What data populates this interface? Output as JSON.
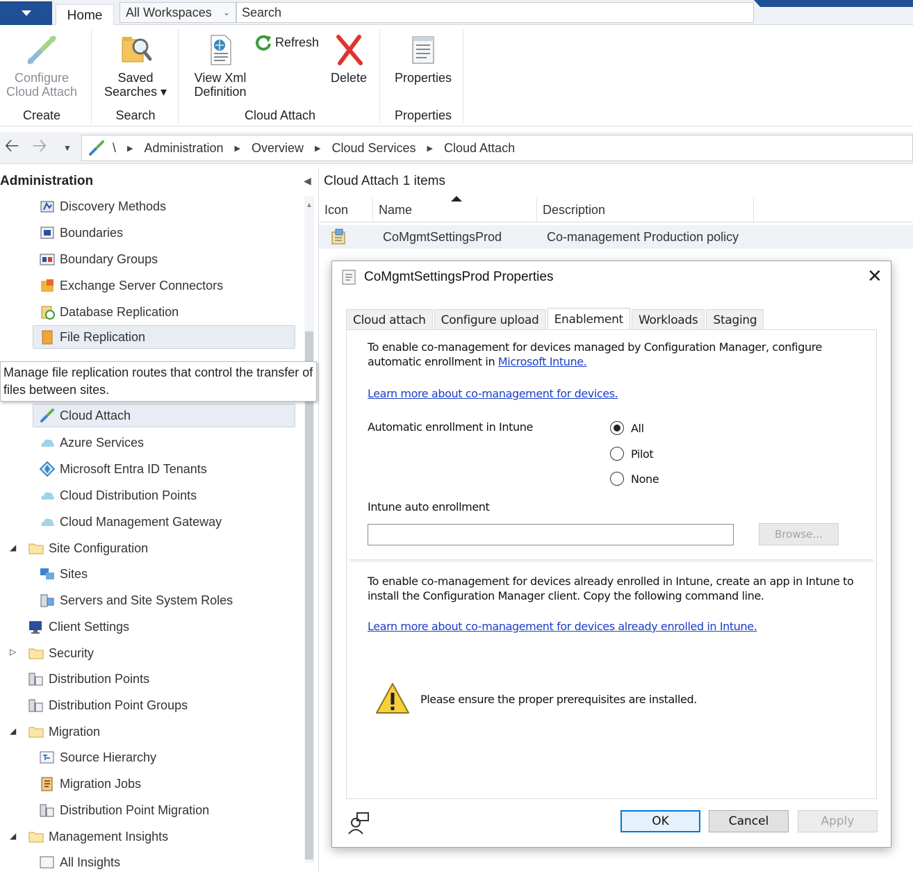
{
  "topbar": {
    "home_tab": "Home",
    "workspace_select": "All Workspaces",
    "search_label": "Search"
  },
  "ribbon": {
    "configure_cloud_attach": {
      "line1": "Configure",
      "line2": "Cloud Attach"
    },
    "saved_searches": {
      "line1": "Saved",
      "line2": "Searches ▾"
    },
    "view_xml": {
      "line1": "View Xml",
      "line2": "Definition"
    },
    "refresh": "Refresh",
    "delete": "Delete",
    "properties": "Properties",
    "groups": {
      "create": "Create",
      "search": "Search",
      "cloud_attach": "Cloud Attach",
      "properties": "Properties"
    }
  },
  "address": {
    "root": "\\",
    "crumbs": [
      "Administration",
      "Overview",
      "Cloud Services",
      "Cloud Attach"
    ]
  },
  "nav": {
    "header": "Administration",
    "items": [
      {
        "label": "Discovery Methods",
        "icon": "discovery-icon"
      },
      {
        "label": "Boundaries",
        "icon": "boundary-icon"
      },
      {
        "label": "Boundary Groups",
        "icon": "boundary-group-icon"
      },
      {
        "label": "Exchange Server Connectors",
        "icon": "exchange-icon"
      },
      {
        "label": "Database Replication",
        "icon": "database-icon"
      },
      {
        "label": "File Replication",
        "icon": "file-replication-icon"
      },
      {
        "label": "Cloud Attach",
        "icon": "cloud-attach-icon"
      },
      {
        "label": "Azure Services",
        "icon": "cloud-icon"
      },
      {
        "label": "Microsoft Entra ID Tenants",
        "icon": "entra-icon"
      },
      {
        "label": "Cloud Distribution Points",
        "icon": "cloud-icon"
      },
      {
        "label": "Cloud Management Gateway",
        "icon": "cloud-icon"
      },
      {
        "label": "Site Configuration",
        "icon": "folder-icon"
      },
      {
        "label": "Sites",
        "icon": "sites-icon"
      },
      {
        "label": "Servers and Site System Roles",
        "icon": "server-icon"
      },
      {
        "label": "Client Settings",
        "icon": "client-settings-icon"
      },
      {
        "label": "Security",
        "icon": "folder-icon"
      },
      {
        "label": "Distribution Points",
        "icon": "distribution-point-icon"
      },
      {
        "label": "Distribution Point Groups",
        "icon": "distribution-point-icon"
      },
      {
        "label": "Migration",
        "icon": "folder-icon"
      },
      {
        "label": "Source Hierarchy",
        "icon": "hierarchy-icon"
      },
      {
        "label": "Migration Jobs",
        "icon": "jobs-icon"
      },
      {
        "label": "Distribution Point Migration",
        "icon": "distribution-point-icon"
      },
      {
        "label": "Management Insights",
        "icon": "folder-icon"
      },
      {
        "label": "All Insights",
        "icon": "insights-icon"
      }
    ],
    "tooltip": "Manage file replication routes that control the transfer of files between sites."
  },
  "list": {
    "title": "Cloud Attach",
    "count": "1 items",
    "columns": [
      "Icon",
      "Name",
      "Description"
    ],
    "rows": [
      {
        "name": "CoMgmtSettingsProd",
        "description": "Co-management Production policy"
      }
    ]
  },
  "dialog": {
    "title": "CoMgmtSettingsProd Properties",
    "tabs": [
      "Cloud attach",
      "Configure upload",
      "Enablement",
      "Workloads",
      "Staging"
    ],
    "active_tab": "Enablement",
    "intro_line1": "To enable co-management for devices managed by Configuration Manager, configure",
    "intro_line2": "automatic enrollment in",
    "intro_link": "Microsoft Intune.",
    "learn_more_link": "Learn more about co-management for devices.",
    "auto_enroll_label": "Automatic enrollment in Intune",
    "radio_options": [
      "All",
      "Pilot",
      "None"
    ],
    "radio_selected": "All",
    "intune_auto_enroll_label": "Intune auto enrollment",
    "intune_auto_enroll_value": "",
    "browse_label": "Browse...",
    "enrolled_line1": "To enable co-management for devices already enrolled in Intune, create an app in Intune to",
    "enrolled_line2": "install the Configuration Manager client. Copy the following command line.",
    "enrolled_link": "Learn more about co-management for devices already enrolled in Intune.",
    "warning_text": "Please ensure the proper prerequisites are installed.",
    "ok": "OK",
    "cancel": "Cancel",
    "apply": "Apply"
  },
  "colors": {
    "accent": "#1f4f94",
    "link": "#1c3fc7",
    "default_button_border": "#0078d7"
  }
}
